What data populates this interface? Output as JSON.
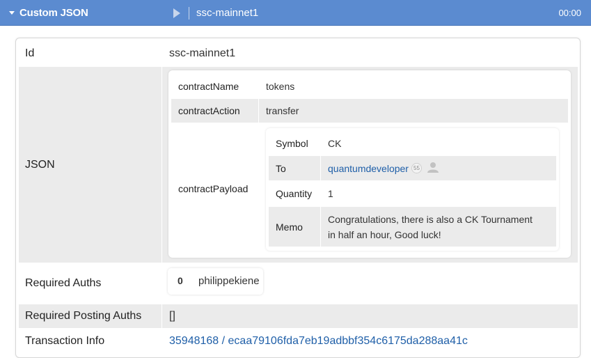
{
  "header": {
    "title": "Custom JSON",
    "network": "ssc-mainnet1",
    "time": "00:00"
  },
  "rows": {
    "id": {
      "label": "Id",
      "value": "ssc-mainnet1"
    },
    "json": {
      "label": "JSON"
    },
    "required_auths": {
      "label": "Required Auths",
      "index": "0",
      "account": "philippekiene"
    },
    "required_posting_auths": {
      "label": "Required Posting Auths",
      "value": "[]"
    },
    "transaction_info": {
      "label": "Transaction Info",
      "block": "35948168",
      "separator": " / ",
      "tx_id": "ecaa79106fda7eb19adbbf354c6175da288aa41c"
    }
  },
  "json": {
    "contract_name": {
      "label": "contractName",
      "value": "tokens"
    },
    "contract_action": {
      "label": "contractAction",
      "value": "transfer"
    },
    "contract_payload": {
      "label": "contractPayload",
      "symbol": {
        "label": "Symbol",
        "value": "CK"
      },
      "to": {
        "label": "To",
        "value": "quantumdeveloper",
        "reputation": "55"
      },
      "quantity": {
        "label": "Quantity",
        "value": "1"
      },
      "memo": {
        "label": "Memo",
        "value": "Congratulations, there is also a CK Tournament in half an hour, Good luck!"
      }
    }
  },
  "colors": {
    "header_bg": "#5b8bd0",
    "row_shade": "#ebebeb",
    "link": "#1f5fa8"
  },
  "icons": [
    "caret-down-icon",
    "play-icon",
    "user-avatar-icon"
  ]
}
